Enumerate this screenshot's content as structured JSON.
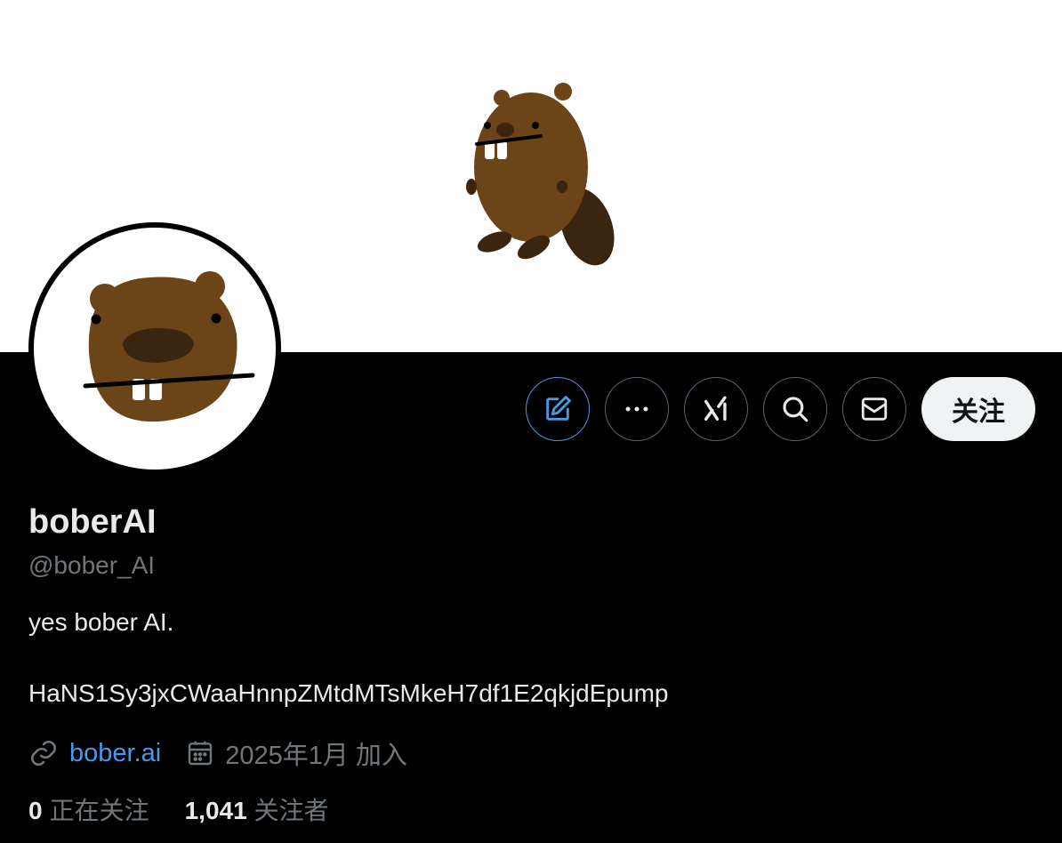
{
  "profile": {
    "display_name": "boberAI",
    "handle": "@bober_AI",
    "bio_line1": "yes bober AI.",
    "bio_line2": "HaNS1Sy3jxCWaaHnnpZMtdMTsMkeH7df1E2qkjdEpump",
    "website": "bober.ai",
    "joined": "2025年1月 加入"
  },
  "stats": {
    "following_count": "0",
    "following_label": "正在关注",
    "followers_count": "1,041",
    "followers_label": "关注者"
  },
  "actions": {
    "follow_label": "关注",
    "icons": [
      "edit-icon",
      "more-icon",
      "grok-icon",
      "search-icon",
      "mail-icon"
    ]
  },
  "colors": {
    "background": "#000000",
    "banner": "#ffffff",
    "accent": "#4a99e9",
    "secondary_text": "#71767b",
    "beaver_brown": "#6b4418"
  }
}
